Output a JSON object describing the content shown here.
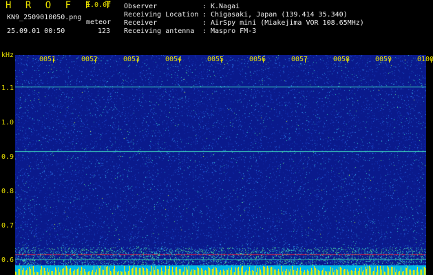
{
  "app": {
    "logo": "H R O F F T",
    "version": "1.0.0f",
    "filename": "KN9_2509010050.png",
    "mode": "meteor",
    "datetime": "25.09.01 00:50",
    "count": "123"
  },
  "meta": {
    "observer_label": "Observer",
    "observer_value": "K.Nagai",
    "location_label": "Receiving Location",
    "location_value": "Chigasaki, Japan (139.414 35.340)",
    "receiver_label": "Receiver",
    "receiver_value": "AirSpy mini (Miakejima VOR 108.65MHz)",
    "antenna_label": "Receiving antenna",
    "antenna_value": "Maspro FM-3",
    "separator": ":"
  },
  "axis": {
    "unit": "kHz",
    "y_ticks": [
      "1.1",
      "1.0",
      "0.9",
      "0.8",
      "0.7",
      "0.6"
    ],
    "x_ticks": [
      "0051",
      "0052",
      "0053",
      "0054",
      "0055",
      "0056",
      "0057",
      "0058",
      "0059",
      "0100"
    ]
  },
  "colors": {
    "background": "#0a1a8c",
    "text_yellow": "#e8e000",
    "carrier_line": "#40e0c0",
    "reference_line": "#e02040"
  }
}
